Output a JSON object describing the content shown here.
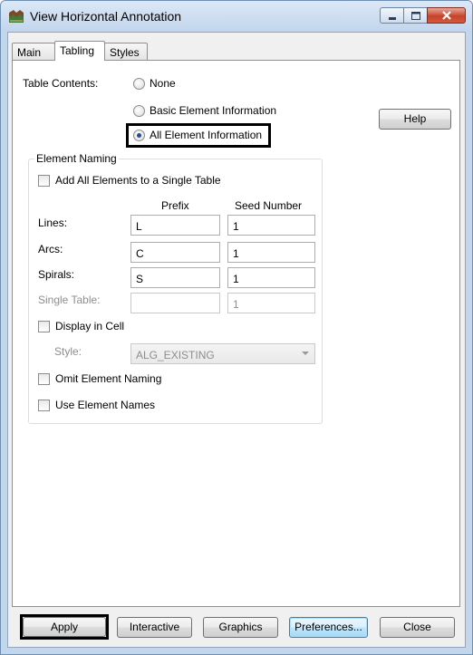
{
  "window": {
    "title": "View Horizontal Annotation",
    "icon": "app-icon"
  },
  "tabs": [
    {
      "label": "Main"
    },
    {
      "label": "Tabling",
      "selected": true
    },
    {
      "label": "Styles"
    }
  ],
  "table_contents": {
    "label": "Table Contents:",
    "options": [
      {
        "label": "None",
        "selected": false
      },
      {
        "label": "Basic Element Information",
        "selected": false
      },
      {
        "label": "All Element Information",
        "selected": true
      }
    ]
  },
  "help_button": "Help",
  "element_naming": {
    "legend": "Element Naming",
    "add_all_checkbox": {
      "label": "Add All Elements to a Single Table",
      "checked": false
    },
    "headers": {
      "prefix": "Prefix",
      "seed": "Seed Number"
    },
    "rows": [
      {
        "label": "Lines:",
        "prefix": "L",
        "seed": "1",
        "disabled": false
      },
      {
        "label": "Arcs:",
        "prefix": "C",
        "seed": "1",
        "disabled": false
      },
      {
        "label": "Spirals:",
        "prefix": "S",
        "seed": "1",
        "disabled": false
      },
      {
        "label": "Single Table:",
        "prefix": "",
        "seed": "1",
        "disabled": true
      }
    ],
    "display_in_cell": {
      "label": "Display in Cell",
      "checked": false
    },
    "style": {
      "label": "Style:",
      "value": "ALG_EXISTING"
    },
    "omit_naming": {
      "label": "Omit Element Naming",
      "checked": false
    },
    "use_names": {
      "label": "Use Element Names",
      "checked": false
    }
  },
  "footer": {
    "apply": "Apply",
    "interactive": "Interactive",
    "graphics": "Graphics",
    "preferences": "Preferences...",
    "close": "Close"
  }
}
